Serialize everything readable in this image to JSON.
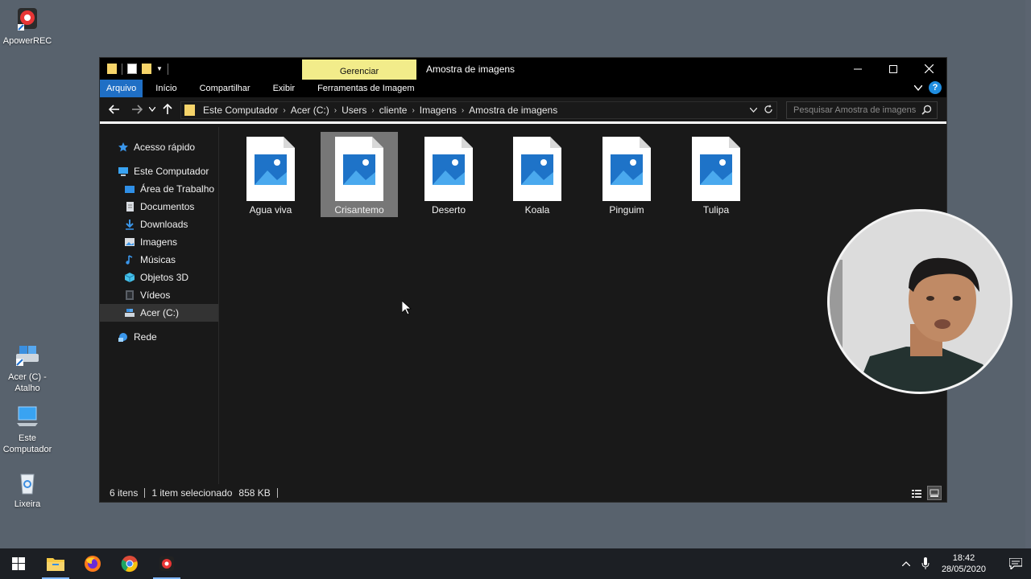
{
  "desktop": {
    "icons": [
      {
        "label": "ApowerREC"
      },
      {
        "label": "Acer (C) -\nAtalho"
      },
      {
        "label": "Este\nComputador"
      },
      {
        "label": "Lixeira"
      }
    ]
  },
  "window": {
    "title": "Amostra de imagens",
    "context_tab": "Gerenciar",
    "ribbon_tabs": [
      "Arquivo",
      "Início",
      "Compartilhar",
      "Exibir",
      "Ferramentas de Imagem"
    ],
    "help": "?",
    "breadcrumbs": [
      "Este Computador",
      "Acer (C:)",
      "Users",
      "cliente",
      "Imagens",
      "Amostra de imagens"
    ],
    "search_placeholder": "Pesquisar Amostra de imagens",
    "nav": {
      "quick_access": "Acesso rápido",
      "this_pc": "Este Computador",
      "children": [
        "Área de Trabalho",
        "Documentos",
        "Downloads",
        "Imagens",
        "Músicas",
        "Objetos 3D",
        "Vídeos",
        "Acer (C:)"
      ],
      "network": "Rede"
    },
    "files": [
      {
        "name": "Agua viva"
      },
      {
        "name": "Crisantemo",
        "selected": true
      },
      {
        "name": "Deserto"
      },
      {
        "name": "Koala"
      },
      {
        "name": "Pinguim"
      },
      {
        "name": "Tulipa"
      }
    ],
    "status": {
      "count": "6 itens",
      "selected": "1 item selecionado",
      "size": "858 KB"
    }
  },
  "taskbar": {
    "time": "18:42",
    "date": "28/05/2020"
  },
  "colors": {
    "accent": "#1f6fc5",
    "context_tab": "#f2ec8a",
    "desktop": "#58626d",
    "window_bg": "#191919"
  }
}
